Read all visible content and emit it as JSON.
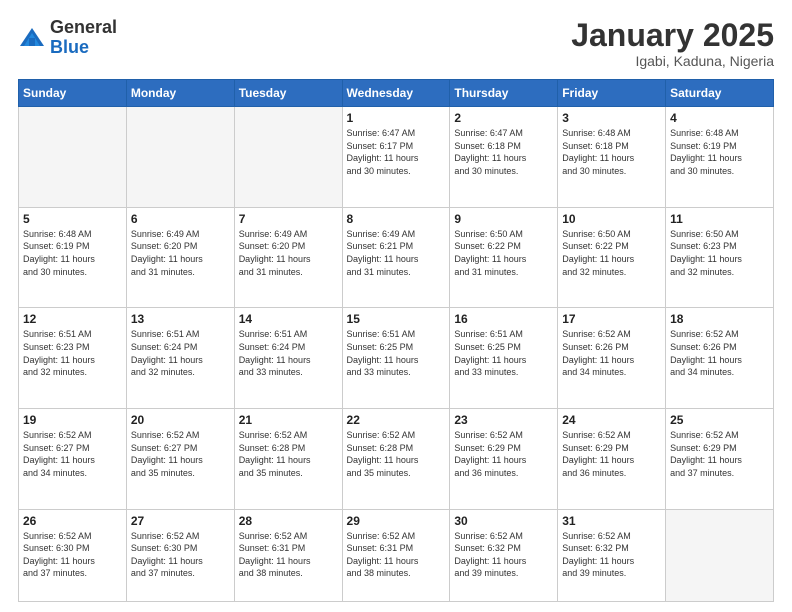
{
  "logo": {
    "general": "General",
    "blue": "Blue"
  },
  "header": {
    "month": "January 2025",
    "location": "Igabi, Kaduna, Nigeria"
  },
  "weekdays": [
    "Sunday",
    "Monday",
    "Tuesday",
    "Wednesday",
    "Thursday",
    "Friday",
    "Saturday"
  ],
  "weeks": [
    [
      {
        "day": "",
        "info": ""
      },
      {
        "day": "",
        "info": ""
      },
      {
        "day": "",
        "info": ""
      },
      {
        "day": "1",
        "info": "Sunrise: 6:47 AM\nSunset: 6:17 PM\nDaylight: 11 hours\nand 30 minutes."
      },
      {
        "day": "2",
        "info": "Sunrise: 6:47 AM\nSunset: 6:18 PM\nDaylight: 11 hours\nand 30 minutes."
      },
      {
        "day": "3",
        "info": "Sunrise: 6:48 AM\nSunset: 6:18 PM\nDaylight: 11 hours\nand 30 minutes."
      },
      {
        "day": "4",
        "info": "Sunrise: 6:48 AM\nSunset: 6:19 PM\nDaylight: 11 hours\nand 30 minutes."
      }
    ],
    [
      {
        "day": "5",
        "info": "Sunrise: 6:48 AM\nSunset: 6:19 PM\nDaylight: 11 hours\nand 30 minutes."
      },
      {
        "day": "6",
        "info": "Sunrise: 6:49 AM\nSunset: 6:20 PM\nDaylight: 11 hours\nand 31 minutes."
      },
      {
        "day": "7",
        "info": "Sunrise: 6:49 AM\nSunset: 6:20 PM\nDaylight: 11 hours\nand 31 minutes."
      },
      {
        "day": "8",
        "info": "Sunrise: 6:49 AM\nSunset: 6:21 PM\nDaylight: 11 hours\nand 31 minutes."
      },
      {
        "day": "9",
        "info": "Sunrise: 6:50 AM\nSunset: 6:22 PM\nDaylight: 11 hours\nand 31 minutes."
      },
      {
        "day": "10",
        "info": "Sunrise: 6:50 AM\nSunset: 6:22 PM\nDaylight: 11 hours\nand 32 minutes."
      },
      {
        "day": "11",
        "info": "Sunrise: 6:50 AM\nSunset: 6:23 PM\nDaylight: 11 hours\nand 32 minutes."
      }
    ],
    [
      {
        "day": "12",
        "info": "Sunrise: 6:51 AM\nSunset: 6:23 PM\nDaylight: 11 hours\nand 32 minutes."
      },
      {
        "day": "13",
        "info": "Sunrise: 6:51 AM\nSunset: 6:24 PM\nDaylight: 11 hours\nand 32 minutes."
      },
      {
        "day": "14",
        "info": "Sunrise: 6:51 AM\nSunset: 6:24 PM\nDaylight: 11 hours\nand 33 minutes."
      },
      {
        "day": "15",
        "info": "Sunrise: 6:51 AM\nSunset: 6:25 PM\nDaylight: 11 hours\nand 33 minutes."
      },
      {
        "day": "16",
        "info": "Sunrise: 6:51 AM\nSunset: 6:25 PM\nDaylight: 11 hours\nand 33 minutes."
      },
      {
        "day": "17",
        "info": "Sunrise: 6:52 AM\nSunset: 6:26 PM\nDaylight: 11 hours\nand 34 minutes."
      },
      {
        "day": "18",
        "info": "Sunrise: 6:52 AM\nSunset: 6:26 PM\nDaylight: 11 hours\nand 34 minutes."
      }
    ],
    [
      {
        "day": "19",
        "info": "Sunrise: 6:52 AM\nSunset: 6:27 PM\nDaylight: 11 hours\nand 34 minutes."
      },
      {
        "day": "20",
        "info": "Sunrise: 6:52 AM\nSunset: 6:27 PM\nDaylight: 11 hours\nand 35 minutes."
      },
      {
        "day": "21",
        "info": "Sunrise: 6:52 AM\nSunset: 6:28 PM\nDaylight: 11 hours\nand 35 minutes."
      },
      {
        "day": "22",
        "info": "Sunrise: 6:52 AM\nSunset: 6:28 PM\nDaylight: 11 hours\nand 35 minutes."
      },
      {
        "day": "23",
        "info": "Sunrise: 6:52 AM\nSunset: 6:29 PM\nDaylight: 11 hours\nand 36 minutes."
      },
      {
        "day": "24",
        "info": "Sunrise: 6:52 AM\nSunset: 6:29 PM\nDaylight: 11 hours\nand 36 minutes."
      },
      {
        "day": "25",
        "info": "Sunrise: 6:52 AM\nSunset: 6:29 PM\nDaylight: 11 hours\nand 37 minutes."
      }
    ],
    [
      {
        "day": "26",
        "info": "Sunrise: 6:52 AM\nSunset: 6:30 PM\nDaylight: 11 hours\nand 37 minutes."
      },
      {
        "day": "27",
        "info": "Sunrise: 6:52 AM\nSunset: 6:30 PM\nDaylight: 11 hours\nand 37 minutes."
      },
      {
        "day": "28",
        "info": "Sunrise: 6:52 AM\nSunset: 6:31 PM\nDaylight: 11 hours\nand 38 minutes."
      },
      {
        "day": "29",
        "info": "Sunrise: 6:52 AM\nSunset: 6:31 PM\nDaylight: 11 hours\nand 38 minutes."
      },
      {
        "day": "30",
        "info": "Sunrise: 6:52 AM\nSunset: 6:32 PM\nDaylight: 11 hours\nand 39 minutes."
      },
      {
        "day": "31",
        "info": "Sunrise: 6:52 AM\nSunset: 6:32 PM\nDaylight: 11 hours\nand 39 minutes."
      },
      {
        "day": "",
        "info": ""
      }
    ]
  ]
}
